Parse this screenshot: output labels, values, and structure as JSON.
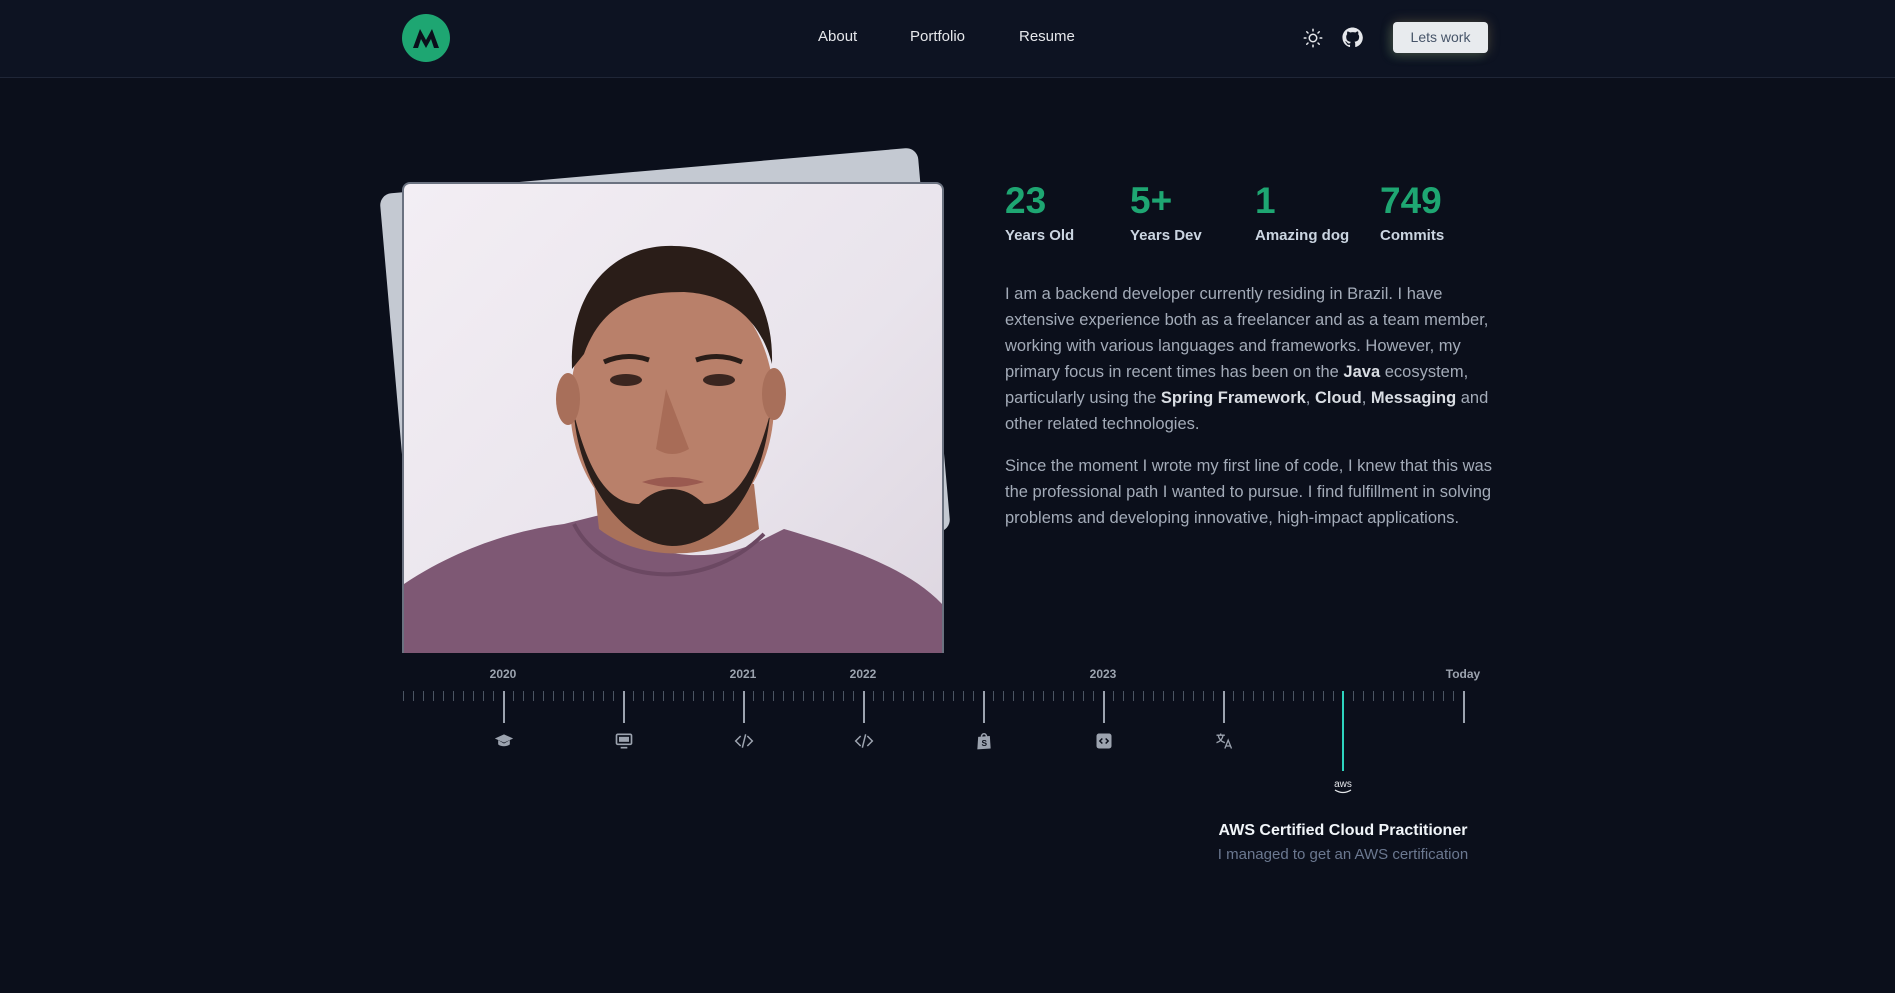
{
  "nav": {
    "logo_letter": "M",
    "links": [
      "About",
      "Portfolio",
      "Resume"
    ],
    "icons": [
      "sun-icon",
      "github-icon"
    ],
    "cta_label": "Lets work"
  },
  "stats": [
    {
      "value": "23",
      "label": "Years Old"
    },
    {
      "value": "5+",
      "label": "Years Dev"
    },
    {
      "value": "1",
      "label": "Amazing dog"
    },
    {
      "value": "749",
      "label": "Commits"
    }
  ],
  "about": {
    "p1_parts": [
      "I am a backend developer currently residing in Brazil. I have extensive experience both as a freelancer and as a team member, working with various languages and frameworks. However, my primary focus in recent times has been on the ",
      "Java",
      " ecosystem, particularly using the ",
      "Spring Framework",
      ", ",
      "Cloud",
      ", ",
      "Messaging",
      " and other related technologies."
    ],
    "p2": "Since the moment I wrote my first line of code, I knew that this was the professional path I wanted to pursue. I find fulfillment in solving problems and developing innovative, high-impact applications."
  },
  "timeline": {
    "years": [
      "2020",
      "2021",
      "2022",
      "2023",
      "Today"
    ],
    "event_icons": [
      "graduation-cap-icon",
      "monitor-icon",
      "code-icon",
      "code-icon",
      "shopify-bag-icon",
      "code-square-icon",
      "translate-icon",
      "aws-icon"
    ],
    "active_event": {
      "title": "AWS Certified Cloud Practitioner",
      "description": "I managed to get an AWS certification",
      "icon_text": "aws"
    }
  },
  "colors": {
    "accent": "#1ea672",
    "background": "#0b0f1b",
    "timeline_active": "#2dd4bf"
  }
}
